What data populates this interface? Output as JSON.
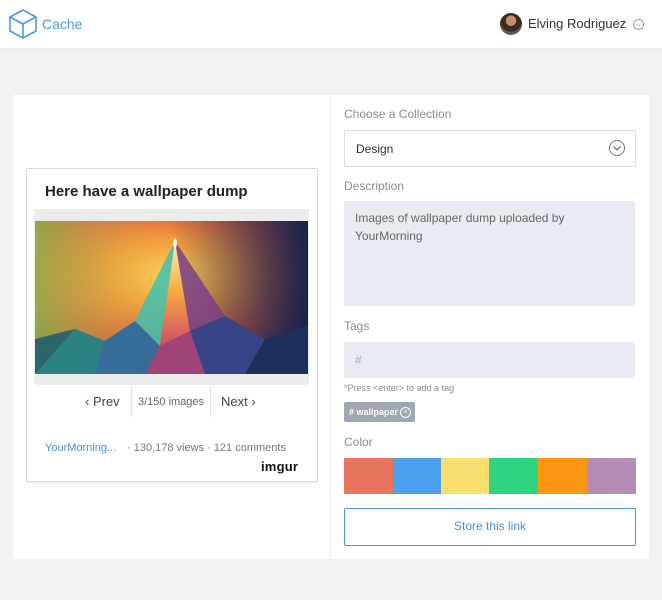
{
  "header": {
    "brand": "Cache",
    "username": "Elving Rodriguez"
  },
  "preview": {
    "title": "Here have a wallpaper dump",
    "nav": {
      "prev": "‹ Prev",
      "count": "3/150 images",
      "next": "Next ›"
    },
    "author": "YourMorning...",
    "stats": "· 130,178 views · 121 comments",
    "source": "imgur"
  },
  "form": {
    "collection_label": "Choose a Collection",
    "collection_value": "Design",
    "description_label": "Description",
    "description_text": "Images of wallpaper dump uploaded by YourMorning",
    "tags_label": "Tags",
    "tags_placeholder": "#",
    "tags_hint": "*Press <enter> to add a tag",
    "tags": [
      "# wallpaper"
    ],
    "color_label": "Color",
    "colors": [
      "#e8735f",
      "#4ba1ee",
      "#f7de6f",
      "#2ed47f",
      "#fd9711",
      "#b48cb5"
    ],
    "submit_label": "Store this link"
  }
}
